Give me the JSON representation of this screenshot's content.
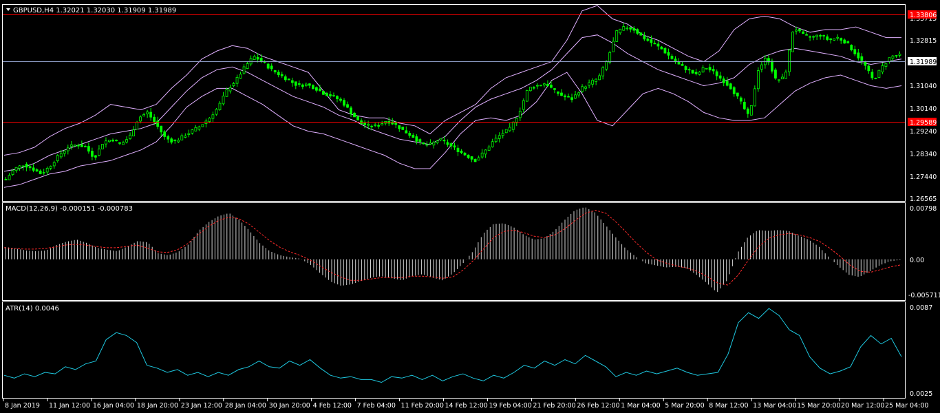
{
  "colors": {
    "background": "#000000",
    "frame": "#ffffff",
    "candle": "#00ff00",
    "bands": "#e0b0ff",
    "level_line": "#ff0000",
    "bid_line": "#8c9ac4",
    "macd_hist": "#d6d6d6",
    "macd_signal": "#ff2a2a",
    "atr": "#1ec8e0",
    "text": "#ffffff",
    "label_red_bg": "#ff0000",
    "label_bid_bg": "#ffffff"
  },
  "main_panel": {
    "header": "GBPUSD,H4  1.32021 1.32030 1.31909 1.31989",
    "menu_icon": "triangle-down-icon",
    "price_labels": [
      "1.32815",
      "1.31040",
      "1.30140",
      "1.29240",
      "1.28340",
      "1.27440",
      "1.26565"
    ],
    "partial_top_label": "1.33715",
    "level_high": "1.33806",
    "level_low": "1.29589",
    "bid_label": "1.31989"
  },
  "macd_panel": {
    "header": "MACD(12,26,9) -0.000151 -0.000783",
    "labels": [
      "0.00798",
      "0.00",
      "-0.005711"
    ]
  },
  "atr_panel": {
    "header": "ATR(14) 0.0046",
    "labels": [
      "0.0087",
      "0.0025"
    ]
  },
  "time_axis": [
    "8 Jan 2019",
    "11 Jan 12:00",
    "16 Jan 04:00",
    "18 Jan 20:00",
    "23 Jan 12:00",
    "28 Jan 04:00",
    "30 Jan 20:00",
    "4 Feb 12:00",
    "7 Feb 04:00",
    "11 Feb 20:00",
    "14 Feb 12:00",
    "19 Feb 04:00",
    "21 Feb 20:00",
    "26 Feb 12:00",
    "1 Mar 04:00",
    "5 Mar 20:00",
    "8 Mar 12:00",
    "13 Mar 04:00",
    "15 Mar 20:00",
    "20 Mar 12:00",
    "25 Mar 04:00"
  ],
  "chart_data": {
    "type": "candlestick",
    "symbol": "GBPUSD",
    "timeframe": "H4",
    "ylim": [
      1.26565,
      1.3385
    ],
    "close_path": [
      1.2735,
      1.2775,
      1.279,
      1.2775,
      1.2755,
      1.2785,
      1.2825,
      1.2855,
      1.2865,
      1.2855,
      1.2815,
      1.2875,
      1.2885,
      1.2865,
      1.2895,
      1.2965,
      1.2985,
      1.294,
      1.289,
      1.2875,
      1.2895,
      1.2915,
      1.2935,
      1.2965,
      1.3005,
      1.307,
      1.3105,
      1.3155,
      1.3195,
      1.3175,
      1.3145,
      1.3125,
      1.3105,
      1.3085,
      1.309,
      1.3075,
      1.3055,
      1.3045,
      1.3025,
      1.2985,
      1.2945,
      1.2935,
      1.2935,
      1.2955,
      1.294,
      1.2915,
      1.2895,
      1.2865,
      1.2865,
      1.2885,
      1.2865,
      1.2845,
      1.2825,
      1.2805,
      1.2835,
      1.2875,
      1.2905,
      1.2925,
      1.2985,
      1.3075,
      1.3085,
      1.3095,
      1.3065,
      1.3045,
      1.3035,
      1.3075,
      1.3095,
      1.3115,
      1.3185,
      1.3285,
      1.3305,
      1.3295,
      1.3265,
      1.3245,
      1.3225,
      1.3195,
      1.3165,
      1.3145,
      1.3125,
      1.3155,
      1.3135,
      1.3105,
      1.3075,
      1.3025,
      1.2965,
      1.3145,
      1.3195,
      1.3105,
      1.3115,
      1.3305,
      1.3275,
      1.3265,
      1.3275,
      1.3255,
      1.3265,
      1.3245,
      1.3205,
      1.3165,
      1.3105,
      1.3155,
      1.3195,
      1.3198
    ],
    "bollinger_upper": [
      1.2825,
      1.2835,
      1.2855,
      1.2895,
      1.2925,
      1.2945,
      1.2975,
      1.3015,
      1.3005,
      1.2995,
      1.3015,
      1.3075,
      1.3125,
      1.3185,
      1.3215,
      1.3235,
      1.3225,
      1.3195,
      1.3175,
      1.3155,
      1.3135,
      1.3065,
      1.2995,
      1.2975,
      1.2965,
      1.2965,
      1.2945,
      1.2935,
      1.2905,
      1.2955,
      1.2985,
      1.3015,
      1.3075,
      1.3115,
      1.3135,
      1.3155,
      1.3175,
      1.3255,
      1.3365,
      1.3385,
      1.3335,
      1.3315,
      1.3275,
      1.3255,
      1.3225,
      1.3195,
      1.3175,
      1.3215,
      1.3295,
      1.3335,
      1.3345,
      1.3335,
      1.3305,
      1.3285,
      1.3295,
      1.3295,
      1.3305,
      1.3285,
      1.3265,
      1.3265
    ],
    "bollinger_middle": [
      1.2765,
      1.2775,
      1.2795,
      1.2825,
      1.2845,
      1.2865,
      1.2885,
      1.2905,
      1.2915,
      1.2925,
      1.2945,
      1.3005,
      1.3065,
      1.3115,
      1.3145,
      1.3155,
      1.3135,
      1.3105,
      1.3075,
      1.3045,
      1.3025,
      1.3005,
      1.2975,
      1.2955,
      1.2925,
      1.2905,
      1.2885,
      1.2875,
      1.2865,
      1.2895,
      1.2955,
      1.3005,
      1.3035,
      1.3055,
      1.3075,
      1.3105,
      1.3145,
      1.3205,
      1.3265,
      1.3275,
      1.3245,
      1.3205,
      1.3175,
      1.3145,
      1.3125,
      1.3105,
      1.3085,
      1.3095,
      1.3115,
      1.3165,
      1.3195,
      1.3215,
      1.3225,
      1.3215,
      1.3205,
      1.3195,
      1.3175,
      1.3165,
      1.3175,
      1.3185
    ],
    "bollinger_lower": [
      1.2705,
      1.2715,
      1.2735,
      1.2755,
      1.2765,
      1.2785,
      1.2795,
      1.2805,
      1.2825,
      1.2845,
      1.2875,
      1.2935,
      1.3005,
      1.3045,
      1.3075,
      1.3075,
      1.3045,
      1.3015,
      1.2975,
      1.2935,
      1.2915,
      1.2905,
      1.2885,
      1.2865,
      1.2845,
      1.2825,
      1.2795,
      1.2775,
      1.2775,
      1.2835,
      1.2905,
      1.2955,
      1.2965,
      1.2955,
      1.2975,
      1.3025,
      1.3105,
      1.3135,
      1.3055,
      1.2955,
      1.2935,
      1.2995,
      1.3055,
      1.3075,
      1.3055,
      1.3025,
      1.2985,
      1.2965,
      1.2955,
      1.2955,
      1.2965,
      1.3015,
      1.3065,
      1.3095,
      1.3115,
      1.3125,
      1.3105,
      1.3085,
      1.3075,
      1.3085
    ],
    "macd": {
      "ylim": [
        -0.005711,
        0.00798
      ],
      "histogram": [
        0.0018,
        0.0016,
        0.0013,
        0.0012,
        0.0013,
        0.0021,
        0.0026,
        0.0029,
        0.0024,
        0.0017,
        0.0014,
        0.0012,
        0.0019,
        0.0027,
        0.0025,
        0.0009,
        0.0006,
        0.0011,
        0.0022,
        0.0042,
        0.0055,
        0.0064,
        0.0068,
        0.0058,
        0.0042,
        0.0024,
        0.0012,
        0.0006,
        0.0003,
        0.0001,
        -0.0008,
        -0.0021,
        -0.0033,
        -0.0039,
        -0.0037,
        -0.0032,
        -0.0027,
        -0.0025,
        -0.0028,
        -0.0031,
        -0.0025,
        -0.0022,
        -0.0027,
        -0.0031,
        -0.0021,
        -0.0006,
        0.0012,
        0.0038,
        0.0052,
        0.0053,
        0.0047,
        0.0036,
        0.0029,
        0.0031,
        0.0042,
        0.0058,
        0.0072,
        0.0077,
        0.0069,
        0.0051,
        0.0033,
        0.0016,
        0.0004,
        -0.0006,
        -0.0009,
        -0.0012,
        -0.0011,
        -0.0013,
        -0.0023,
        -0.0035,
        -0.0049,
        -0.0031,
        0.0009,
        0.0032,
        0.0043,
        0.0042,
        0.0043,
        0.0042,
        0.0035,
        0.0029,
        0.0019,
        0.0003,
        -0.0011,
        -0.0023,
        -0.0026,
        -0.0018,
        -0.0009,
        -0.0003,
        -0.0001
      ],
      "signal": [
        0.0017,
        0.0016,
        0.0015,
        0.0015,
        0.0016,
        0.0018,
        0.0021,
        0.0022,
        0.0021,
        0.0019,
        0.0017,
        0.0017,
        0.0019,
        0.0021,
        0.0017,
        0.0011,
        0.001,
        0.0014,
        0.0023,
        0.0036,
        0.0048,
        0.0057,
        0.0062,
        0.006,
        0.0052,
        0.004,
        0.0028,
        0.0018,
        0.0011,
        0.0006,
        -0.0001,
        -0.001,
        -0.0019,
        -0.0026,
        -0.0031,
        -0.0031,
        -0.0029,
        -0.0027,
        -0.0027,
        -0.0027,
        -0.0025,
        -0.0025,
        -0.0026,
        -0.0028,
        -0.0026,
        -0.0016,
        -0.0002,
        0.0015,
        0.0032,
        0.0041,
        0.0043,
        0.0039,
        0.0034,
        0.0032,
        0.0036,
        0.0045,
        0.0057,
        0.0068,
        0.0072,
        0.0068,
        0.0055,
        0.004,
        0.0024,
        0.001,
        -0.0001,
        -0.0006,
        -0.001,
        -0.0013,
        -0.0018,
        -0.0026,
        -0.0035,
        -0.0038,
        -0.0023,
        -0.0001,
        0.0019,
        0.0031,
        0.0036,
        0.0038,
        0.0036,
        0.0032,
        0.0026,
        0.0016,
        0.0004,
        -0.0009,
        -0.0018,
        -0.0019,
        -0.0015,
        -0.0011,
        -0.0008
      ]
    },
    "atr": {
      "ylim": [
        0.0025,
        0.0087
      ],
      "values": [
        0.0038,
        0.0036,
        0.0039,
        0.0037,
        0.004,
        0.0039,
        0.0044,
        0.0042,
        0.0046,
        0.0048,
        0.0063,
        0.0068,
        0.0066,
        0.0061,
        0.0045,
        0.0043,
        0.004,
        0.0042,
        0.0038,
        0.004,
        0.0037,
        0.004,
        0.0038,
        0.0042,
        0.0044,
        0.0048,
        0.0044,
        0.0043,
        0.0048,
        0.0045,
        0.0049,
        0.0043,
        0.0038,
        0.0036,
        0.0037,
        0.0035,
        0.0035,
        0.0033,
        0.0037,
        0.0036,
        0.0038,
        0.0035,
        0.0038,
        0.0034,
        0.0037,
        0.0039,
        0.0036,
        0.0034,
        0.0038,
        0.0036,
        0.004,
        0.0045,
        0.0043,
        0.0048,
        0.0045,
        0.0049,
        0.0046,
        0.0052,
        0.0048,
        0.0044,
        0.0037,
        0.004,
        0.0038,
        0.0041,
        0.0039,
        0.0041,
        0.0043,
        0.004,
        0.0038,
        0.0039,
        0.004,
        0.0053,
        0.0075,
        0.0082,
        0.0078,
        0.0085,
        0.008,
        0.007,
        0.0066,
        0.0051,
        0.0043,
        0.0039,
        0.0041,
        0.0044,
        0.0058,
        0.0066,
        0.006,
        0.0064,
        0.0051
      ]
    }
  }
}
